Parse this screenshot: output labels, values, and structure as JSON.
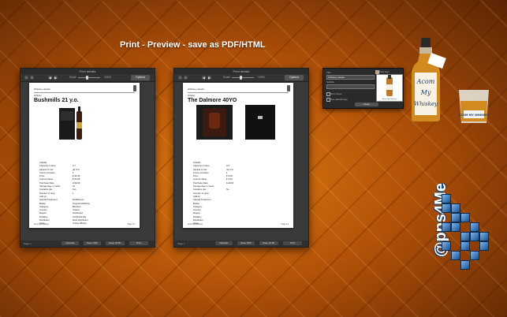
{
  "headline": "Print - Preview - save as PDF/HTML",
  "windows": [
    {
      "window_title": "Print details",
      "zoom": "100%",
      "options_label": "Options",
      "paper": {
        "title": "Whiskey details",
        "whisky_label": "Whisky",
        "name": "Bushmills 21 y.o."
      },
      "footer_left": "Acom My Whiskey",
      "footer_right": "Page 1/1",
      "page_count": "Page 1",
      "buttons": [
        "Defaults",
        "Save PDF",
        "Save HTML",
        "Print"
      ]
    },
    {
      "window_title": "Print details",
      "zoom": "100%",
      "options_label": "Options",
      "paper": {
        "title": "Whiskey details",
        "whisky_label": "Whisky",
        "name": "The Dalmore 40YO"
      },
      "footer_left": "Acom My Whiskey",
      "footer_right": "Page 1/1",
      "page_count": "Page 1",
      "buttons": [
        "Defaults",
        "Save PDF",
        "Save HTML",
        "Print"
      ]
    }
  ],
  "specs_left": [
    [
      "Subtitle",
      ""
    ],
    [
      "Capacity in litres",
      "0.7"
    ],
    [
      "Alcohol % Vol.",
      "40.0 %"
    ],
    [
      "Count of bottles",
      "1"
    ],
    [
      "Price",
      "€ 94.99"
    ],
    [
      "Current Value",
      "€ 94.99"
    ],
    [
      "Purchase Date",
      "2/24/16"
    ],
    [
      "Storage/Age in Years",
      "21"
    ],
    [
      "Contains dye",
      "Yes"
    ],
    [
      "Number of dyes",
      "1"
    ],
    [
      "Add-on",
      ""
    ],
    [
      "Special Treatment",
      "Multiflavour"
    ],
    [
      "Bottler",
      "Original Abfüllung"
    ],
    [
      "Category",
      "Blended"
    ],
    [
      "Country",
      "Ireland"
    ],
    [
      "Region",
      "Nordirland"
    ],
    [
      "Distillery",
      "Old Bushmills"
    ],
    [
      "Distributor",
      "Moet Distributor"
    ],
    [
      "Store",
      "Online Whisky"
    ]
  ],
  "specs_right": [
    [
      "Subtitle",
      ""
    ],
    [
      "Capacity in litres",
      "0.5"
    ],
    [
      "Alcohol % Vol.",
      "42.0 %"
    ],
    [
      "Count of bottles",
      "1"
    ],
    [
      "Price",
      "€ 0.00"
    ],
    [
      "Current Value",
      "€ 0.00"
    ],
    [
      "Purchase Date",
      "11/4/15"
    ],
    [
      "Storage/Age in Years",
      ""
    ],
    [
      "Contains dye",
      "No"
    ],
    [
      "Number of dyes",
      ""
    ],
    [
      "Add-on",
      ""
    ],
    [
      "Special Treatment",
      ""
    ],
    [
      "Bottler",
      ""
    ],
    [
      "Category",
      ""
    ],
    [
      "Country",
      ""
    ],
    [
      "Region",
      ""
    ],
    [
      "Distillery",
      ""
    ],
    [
      "Distributor",
      ""
    ],
    [
      "Store",
      ""
    ]
  ],
  "panel": {
    "title_label": "Title",
    "title_value": "Whiskey details",
    "subtitle_label": "Subtitle",
    "print_logo_label": "Print logo",
    "print footer_label": "Print footer",
    "default_logo_label": "Use default logo",
    "close_label": "Close",
    "thumb_caption": "Acom My Whiskey"
  },
  "bottle_label": [
    "Acom",
    "My",
    "Whiskey"
  ],
  "glass_label": "ACOM MY WHISKEY",
  "brand_logo": "@pps4Me",
  "colors": {
    "accent": "#e07a12",
    "logo_blue": "#1a4f8c"
  }
}
